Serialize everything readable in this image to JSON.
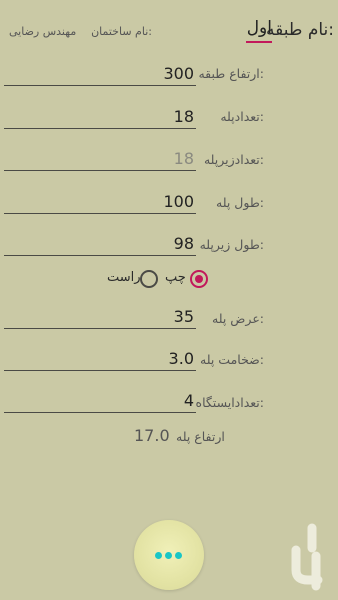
{
  "header": {
    "floor_name_label": "نام طبقه:",
    "floor_name_value": "اول",
    "building_name_label": "نام ساختمان:",
    "building_name_value": "مهندس رضایی"
  },
  "form": {
    "floor_height": {
      "label": "ارتفاع طبقه:",
      "value": "300"
    },
    "stair_count": {
      "label": "تعدادپله:",
      "value": "18"
    },
    "under_stair_count": {
      "label": "تعدادزیرپله:",
      "hint": "18"
    },
    "stair_length": {
      "label": "طول پله:",
      "value": "100"
    },
    "under_stair_length": {
      "label": "طول زیرپله:",
      "value": "98"
    },
    "direction": {
      "option_left": "چپ",
      "option_right": "راست",
      "selected": "چپ"
    },
    "stair_width": {
      "label": "عرض پله:",
      "value": "35"
    },
    "stair_thickness": {
      "label": "ضخامت پله:",
      "value": "3.0"
    },
    "landing_count": {
      "label": "تعدادایستگاه:",
      "value": "4"
    }
  },
  "result": {
    "label": "ارتفاع پله",
    "value": "17.0"
  },
  "fab": {
    "icon": "more-dots-icon"
  },
  "watermark": {
    "text": "بازار"
  },
  "colors": {
    "background": "#cac9a5",
    "accent": "#c2185b",
    "fab_dots": "#19c6c6"
  }
}
